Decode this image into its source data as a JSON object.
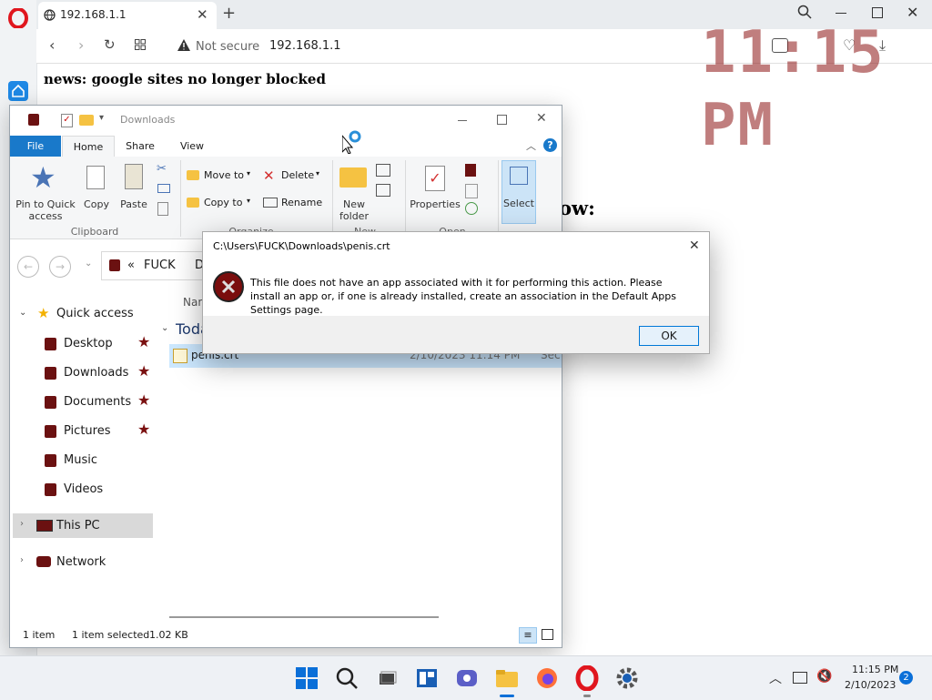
{
  "browser": {
    "tab_title": "192.168.1.1",
    "security_label": "Not secure",
    "url": "192.168.1.1",
    "clock_overlay": "11:15 PM"
  },
  "page": {
    "news": "news: google sites no longer blocked",
    "partial_text": "ow:"
  },
  "explorer": {
    "title": "Downloads",
    "ribbon_tabs": [
      "File",
      "Home",
      "Share",
      "View"
    ],
    "clipboard": {
      "pin": "Pin to Quick access",
      "copy": "Copy",
      "paste": "Paste",
      "group": "Clipboard"
    },
    "organize": {
      "move_to": "Move to",
      "copy_to": "Copy to",
      "delete": "Delete",
      "rename": "Rename",
      "group": "Organize"
    },
    "new": {
      "new_folder": "New folder",
      "group": "New"
    },
    "open": {
      "properties": "Properties",
      "group": "Open"
    },
    "select": {
      "label": "Select"
    },
    "breadcrumb": {
      "prefix": "«",
      "part1": "FUCK",
      "part2": "D"
    },
    "column_name": "Nam",
    "group_header": "Toda",
    "file": {
      "name": "penis.crt",
      "date": "2/10/2023 11:14 PM",
      "type": "Sec"
    },
    "quick_access": "Quick access",
    "nav": [
      {
        "label": "Desktop",
        "pinned": true
      },
      {
        "label": "Downloads",
        "pinned": true
      },
      {
        "label": "Documents",
        "pinned": true
      },
      {
        "label": "Pictures",
        "pinned": true
      },
      {
        "label": "Music",
        "pinned": false
      },
      {
        "label": "Videos",
        "pinned": false
      }
    ],
    "this_pc": "This PC",
    "network": "Network",
    "status": {
      "count": "1 item",
      "selected": "1 item selected",
      "size": "1.02 KB"
    }
  },
  "dialog": {
    "title": "C:\\Users\\FUCK\\Downloads\\penis.crt",
    "message": "This file does not have an app associated with it for performing this action. Please install an app or, if one is already installed, create an association in the Default Apps Settings page.",
    "ok": "OK"
  },
  "taskbar": {
    "time": "11:15 PM",
    "date": "2/10/2023",
    "notifications": "2"
  }
}
